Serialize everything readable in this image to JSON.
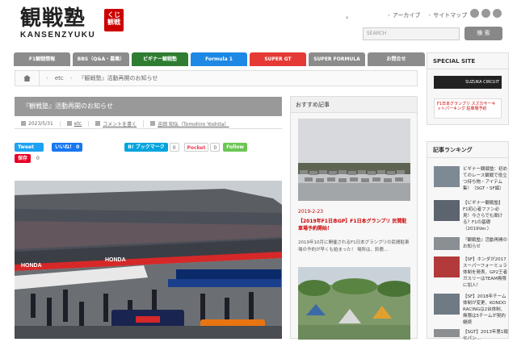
{
  "header": {
    "logo_jp": "観戦塾",
    "logo_badge": "くじ 観戦",
    "logo_en": "KANSENZYUKU",
    "link_archive": "アーカイブ",
    "link_sitemap": "サイトマップ",
    "search_placeholder": "SEARCH",
    "search_button": "検 索"
  },
  "nav": [
    {
      "label": "F1観戦情報",
      "color": "#8c8c8c"
    },
    {
      "label": "BBS（Q&A・募集）",
      "color": "#8c8c8c"
    },
    {
      "label": "ビギナー観戦塾",
      "color": "#2e7d32"
    },
    {
      "label": "Formula 1",
      "color": "#1e88e5"
    },
    {
      "label": "SUPER GT",
      "color": "#e53935"
    },
    {
      "label": "SUPER FORMULA",
      "color": "#8c8c8c"
    },
    {
      "label": "お問合せ",
      "color": "#8c8c8c"
    }
  ],
  "breadcrumb": {
    "level1": "etc",
    "level2": "『観戦塾』活動再開のお知らせ"
  },
  "article": {
    "title": "『観戦塾』活動再開のお知らせ",
    "date": "2023/5/31",
    "category": "etc",
    "comment": "コメントを書く",
    "author": "吉田 知弘（Tomohiro Yoshita）"
  },
  "share": {
    "tweet": "Tweet",
    "like": "いいね！",
    "like_count": "0",
    "hatena": "B! ブックマーク",
    "hatena_count": "0",
    "pocket": "Pocket",
    "pocket_count": "0",
    "feedly": "Follow",
    "save": "保存",
    "save_count": "0"
  },
  "hero": {
    "banner_text": "HONDA"
  },
  "reco": {
    "heading": "おすすめ記事",
    "date": "2019-2-23",
    "link": "【2019年F1日本GP】F1日本グランプリ 民間駐車場予約開始！",
    "snippet": "2019年10月に開催されるF1日本グランプリの民間駐車場の予約が早くも始まった！ 場所は、鈴鹿..."
  },
  "side": {
    "special_heading": "SPECIAL SITE",
    "banner1": "SUZUKA CIRCUIT",
    "banner2": "F1日本グランプリ スズカサーキットパーキング 駐車場予約",
    "ranking_heading": "記事ランキング",
    "rank1": "ビギナー観戦塾：初めてのレース観戦で役立つ持ち物・アイテム集！（SGT・SF編）",
    "rank2": "【ビギナー観戦塾】F1初心者ファン必見！今さらでも聞ける？F1の基礎（2019Ver.）",
    "rank3": "『観戦塾』活動再開のお知らせ",
    "rank4": "【SF】ホンダが2017スーパーフォーミュラ体制を発表、GP2王者ガスリーはTEAM無限に加入！",
    "rank5": "【SF】2018年チーム体制が変更、KONDO RACINGは2台体制、無限は5チームが契約継続",
    "rank6": "【SGT】2013年第1戦セパン..."
  }
}
